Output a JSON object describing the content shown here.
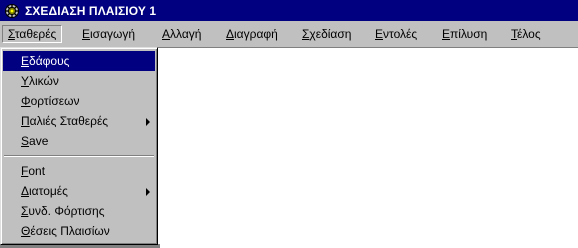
{
  "window": {
    "title": "ΣΧΕΔΙΑΣΗ ΠΛΑΙΣΙΟΥ 1",
    "icon": "gear-icon",
    "colors": {
      "titlebar": "#000080",
      "menu_face": "#c0c0c0",
      "highlight": "#000080",
      "highlight_text": "#ffffff",
      "client": "#ffffff"
    }
  },
  "menubar": {
    "items": [
      {
        "label": "Σταθερές",
        "open": true
      },
      {
        "label": "Εισαγωγή"
      },
      {
        "label": "Αλλαγή"
      },
      {
        "label": "Διαγραφή"
      },
      {
        "label": "Σχεδίαση"
      },
      {
        "label": "Εντολές"
      },
      {
        "label": "Επίλυση"
      },
      {
        "label": "Τέλος"
      }
    ]
  },
  "dropdown": {
    "group1": [
      {
        "label": "Εδάφους",
        "highlighted": true
      },
      {
        "label": "Υλικών"
      },
      {
        "label": "Φορτίσεων"
      },
      {
        "label": "Παλιές Σταθερές",
        "submenu": true
      },
      {
        "label": "Save"
      }
    ],
    "group2": [
      {
        "label": "Font"
      },
      {
        "label": "Διατομές",
        "submenu": true
      },
      {
        "label": "Συνδ. Φόρτισης"
      },
      {
        "label": "Θέσεις Πλαισίων"
      }
    ]
  }
}
